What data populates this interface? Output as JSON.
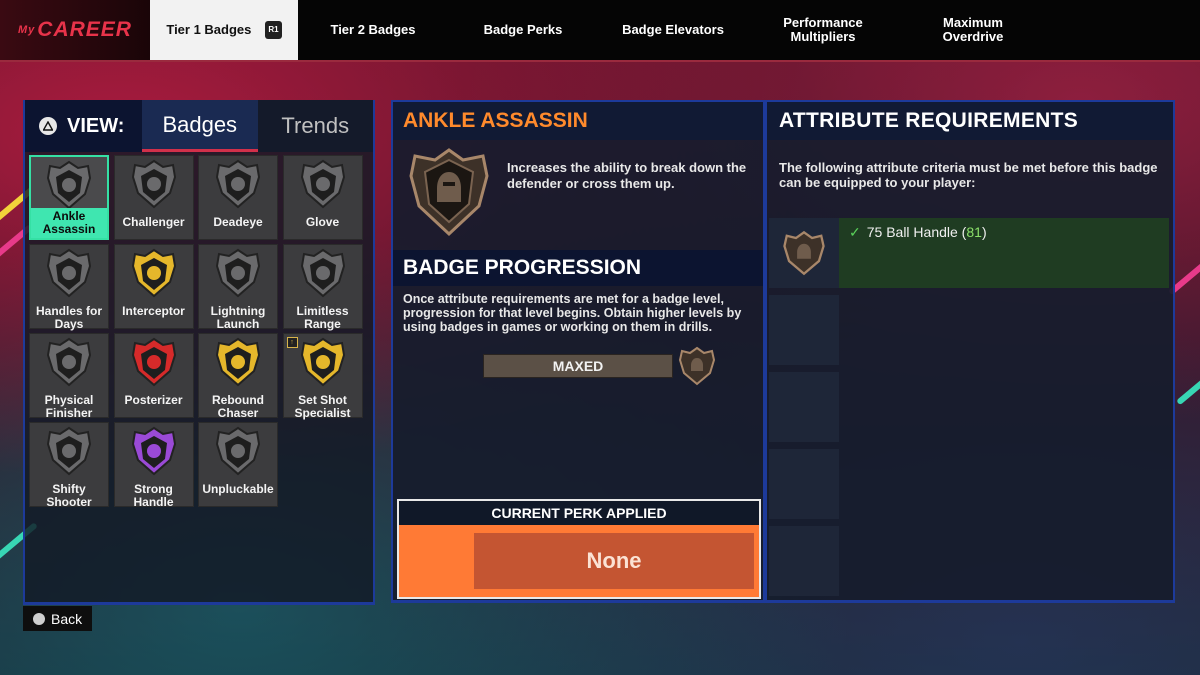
{
  "nav": {
    "logo_prefix": "My",
    "logo": "CAREER",
    "tabs": [
      {
        "label": "Tier 1 Badges",
        "hint": "R1",
        "active": true
      },
      {
        "label": "Tier 2 Badges"
      },
      {
        "label": "Badge Perks"
      },
      {
        "label": "Badge Elevators"
      },
      {
        "label": "Performance Multipliers"
      },
      {
        "label": "Maximum Overdrive"
      }
    ]
  },
  "view": {
    "label": "VIEW:",
    "tabs": [
      "Badges",
      "Trends"
    ],
    "active_tab": "Badges"
  },
  "badges": [
    {
      "name": "Ankle Assassin",
      "selected": true,
      "color": "#6a6a6c"
    },
    {
      "name": "Challenger",
      "color": "#6a6a6c"
    },
    {
      "name": "Deadeye",
      "color": "#6a6a6c"
    },
    {
      "name": "Glove",
      "color": "#6a6a6c"
    },
    {
      "name": "Handles for Days",
      "color": "#6a6a6c"
    },
    {
      "name": "Interceptor",
      "color": "#e5b72b"
    },
    {
      "name": "Lightning Launch",
      "color": "#6a6a6c"
    },
    {
      "name": "Limitless Range",
      "color": "#6a6a6c"
    },
    {
      "name": "Physical Finisher",
      "color": "#6a6a6c"
    },
    {
      "name": "Posterizer",
      "color": "#d62a2a"
    },
    {
      "name": "Rebound Chaser",
      "color": "#e5b72b"
    },
    {
      "name": "Set Shot Specialist",
      "color": "#e5b72b",
      "new": true
    },
    {
      "name": "Shifty Shooter",
      "color": "#6a6a6c"
    },
    {
      "name": "Strong Handle",
      "color": "#9a4ad6"
    },
    {
      "name": "Unpluckable",
      "color": "#6a6a6c"
    }
  ],
  "back_label": "Back",
  "detail": {
    "title": "ANKLE ASSASSIN",
    "description": "Increases the ability to break down the defender or cross them up.",
    "progression_title": "BADGE PROGRESSION",
    "progression_text": "Once attribute requirements are met for a badge level, progression for that level begins. Obtain higher levels by using badges in games or working on them in drills.",
    "progress_label": "MAXED",
    "progress": 1.0,
    "perk_title": "CURRENT PERK APPLIED",
    "perk_value": "None"
  },
  "requirements": {
    "title": "ATTRIBUTE REQUIREMENTS",
    "text": "The following attribute criteria must be met before this badge can be equipped to your player:",
    "items": [
      {
        "requirement": "75 Ball Handle",
        "current": "81",
        "met": true
      }
    ],
    "empty_rows": 4
  },
  "colors": {
    "accent_orange": "#ff8a2c",
    "selected_teal": "#3fe6b0",
    "panel_border": "#1d3a9a",
    "perk_orange": "#ff7a35"
  }
}
